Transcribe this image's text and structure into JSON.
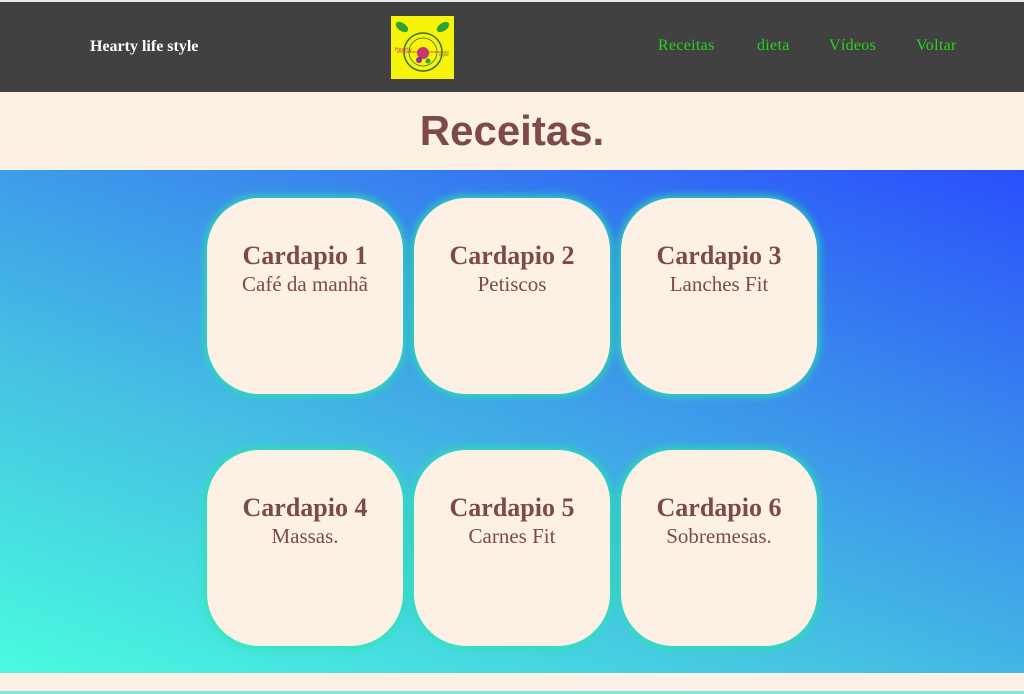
{
  "header": {
    "brand": "Hearty life style",
    "logo_icon": "hearty-life-logo",
    "nav": [
      {
        "label": "Receitas"
      },
      {
        "label": "dieta"
      },
      {
        "label": "Vídeos"
      },
      {
        "label": "Voltar"
      }
    ]
  },
  "page": {
    "title": "Receitas."
  },
  "cards": [
    {
      "title": "Cardapio 1",
      "subtitle": "Café da manhã"
    },
    {
      "title": "Cardapio 2",
      "subtitle": "Petiscos"
    },
    {
      "title": "Cardapio 3",
      "subtitle": "Lanches Fit"
    },
    {
      "title": "Cardapio 4",
      "subtitle": "Massas."
    },
    {
      "title": "Cardapio 5",
      "subtitle": "Carnes Fit"
    },
    {
      "title": "Cardapio 6",
      "subtitle": "Sobremesas."
    }
  ],
  "colors": {
    "navbar": "#414141",
    "nav_link": "#27d21c",
    "title_text": "#7d4a49",
    "card_bg": "#fdf1e6",
    "gradient_top": "#2a4ffc",
    "gradient_bottom": "#48fbe0"
  }
}
